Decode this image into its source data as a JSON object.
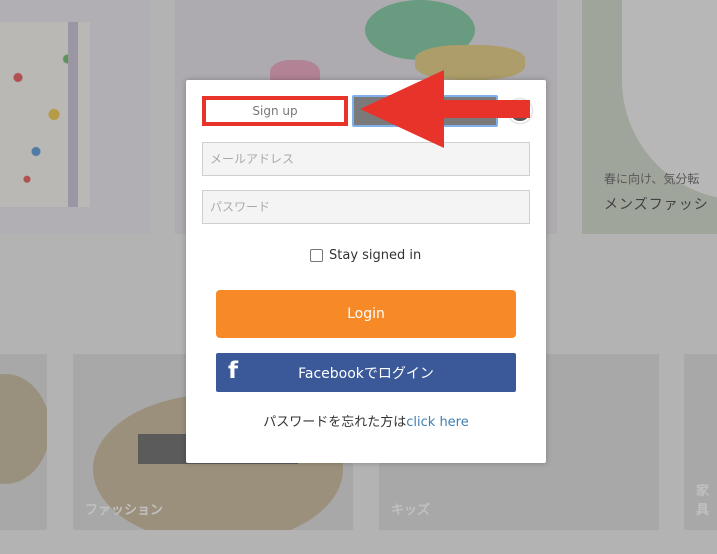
{
  "background": {
    "mens_tile": {
      "line1": "春に向け、気分転",
      "line2": "メンズファッシ"
    },
    "categories": [
      {
        "label": ""
      },
      {
        "label": "ファッション"
      },
      {
        "label": "キッズ"
      },
      {
        "label": "家具"
      }
    ]
  },
  "modal": {
    "signup_label": "Sign up",
    "login_tab_label": "",
    "email_placeholder": "メールアドレス",
    "password_placeholder": "パスワード",
    "stay_signed_in": "Stay signed in",
    "login_button": "Login",
    "facebook_button": "Facebookでログイン",
    "facebook_icon": "f",
    "forgot_prefix": "パスワードを忘れた方は",
    "forgot_link": "click here"
  },
  "annotation": {
    "arrow_color": "#e8332a",
    "highlight_color": "#e8332a"
  },
  "colors": {
    "login_orange": "#f78a26",
    "facebook_blue": "#3b5999",
    "link_blue": "#3e7fb3"
  }
}
